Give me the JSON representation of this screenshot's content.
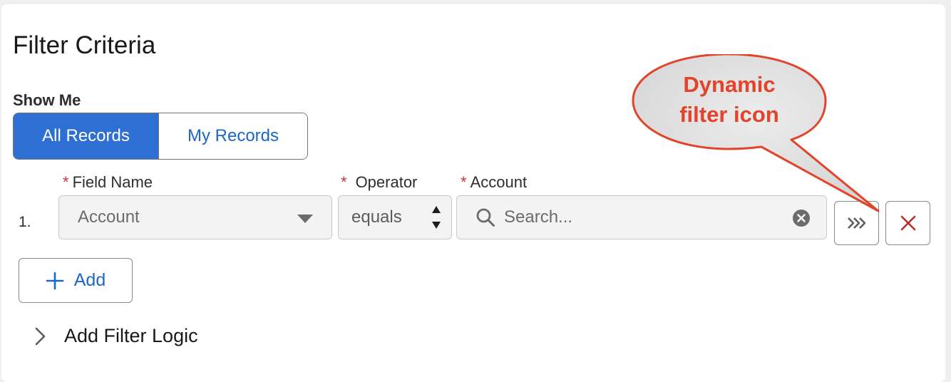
{
  "panel": {
    "title": "Filter Criteria"
  },
  "show_me": {
    "label": "Show Me",
    "options": [
      {
        "label": "All Records",
        "selected": true
      },
      {
        "label": "My Records",
        "selected": false
      }
    ]
  },
  "filter_row": {
    "number": "1.",
    "field_name": {
      "label": "Field Name",
      "required_mark": "*",
      "value": "Account"
    },
    "operator": {
      "label": "Operator",
      "required_mark": "*",
      "value": "equals"
    },
    "account": {
      "label": "Account",
      "required_mark": "*",
      "placeholder": "Search..."
    }
  },
  "actions": {
    "add_label": "Add",
    "add_filter_logic_label": "Add Filter Logic"
  },
  "annotation": {
    "line1": "Dynamic",
    "line2": "filter icon"
  },
  "colors": {
    "brand": "#2d6fd2",
    "link": "#1b67c9",
    "required": "#c23934",
    "delete": "#b5322c",
    "callout_text": "#e2442b"
  },
  "icons": [
    "chevron-down-icon",
    "up-down-icon",
    "search-icon",
    "clear-icon",
    "dynamic-filter-icon",
    "delete-icon",
    "add-icon",
    "chevron-right-icon"
  ]
}
